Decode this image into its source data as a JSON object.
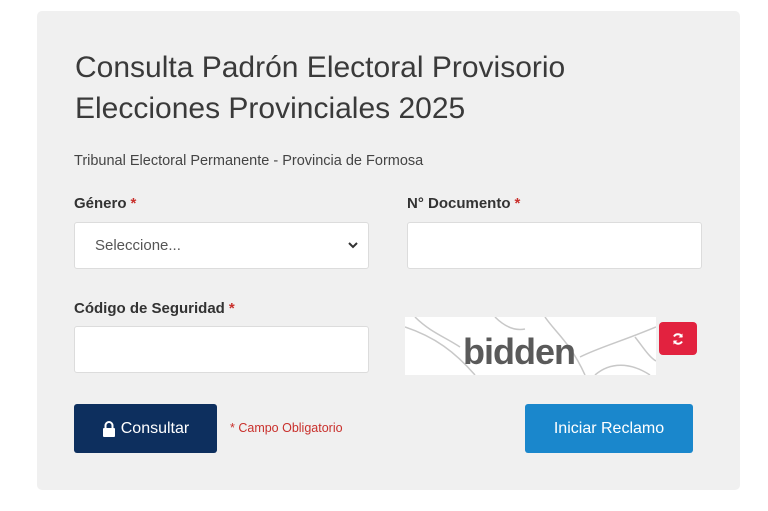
{
  "form": {
    "title_line1": "Consulta Padrón Electoral Provisorio",
    "title_line2": "Elecciones Provinciales 2025",
    "subtitle": "Tribunal Electoral Permanente - Provincia de Formosa",
    "required_mark": "*",
    "genero": {
      "label": "Género",
      "selected": "Seleccione..."
    },
    "documento": {
      "label": "N° Documento",
      "value": ""
    },
    "codigo": {
      "label": "Código de Seguridad",
      "value": ""
    },
    "captcha_text": "bidden",
    "mandatory_note": "* Campo Obligatorio",
    "consultar_label": "Consultar",
    "reclamo_label": "Iniciar Reclamo"
  },
  "colors": {
    "card_bg": "#f0f0f0",
    "primary_dark": "#0d2f5e",
    "primary_blue": "#1a87cc",
    "danger": "#e2223f",
    "required": "#c9302c"
  },
  "icons": {
    "consultar": "lock-icon",
    "refresh": "refresh-icon",
    "select": "chevron-down-icon"
  }
}
